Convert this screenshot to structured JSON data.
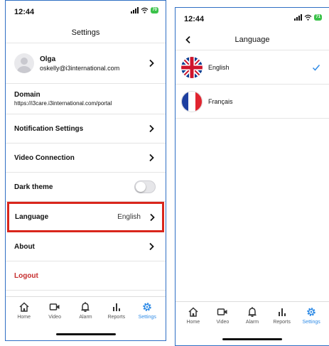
{
  "left_screen": {
    "status_time": "12:44",
    "battery": "70",
    "title": "Settings",
    "profile": {
      "name": "Olga",
      "email": "oskelly@i3international.com"
    },
    "domain": {
      "label": "Domain",
      "url": "https://i3care.i3international.com/portal"
    },
    "items": {
      "notification": "Notification Settings",
      "video": "Video Connection",
      "dark_theme": "Dark theme",
      "language": "Language",
      "language_value": "English",
      "about": "About",
      "logout": "Logout"
    },
    "dark_theme_on": false
  },
  "right_screen": {
    "status_time": "12:44",
    "battery": "71",
    "title": "Language",
    "languages": [
      {
        "name": "English",
        "selected": true,
        "flag": "uk-flag"
      },
      {
        "name": "Français",
        "selected": false,
        "flag": "fr-flag"
      }
    ]
  },
  "tabbar": {
    "tabs": [
      {
        "label": "Home",
        "icon": "home-icon"
      },
      {
        "label": "Video",
        "icon": "video-icon"
      },
      {
        "label": "Alarm",
        "icon": "bell-icon"
      },
      {
        "label": "Reports",
        "icon": "bar-chart-icon"
      },
      {
        "label": "Settings",
        "icon": "gear-icon"
      }
    ],
    "active": "Settings"
  },
  "colors": {
    "accent": "#2f8be6",
    "highlight": "#d9261c",
    "logout": "#c62d2d",
    "battery": "#3bc24a"
  }
}
